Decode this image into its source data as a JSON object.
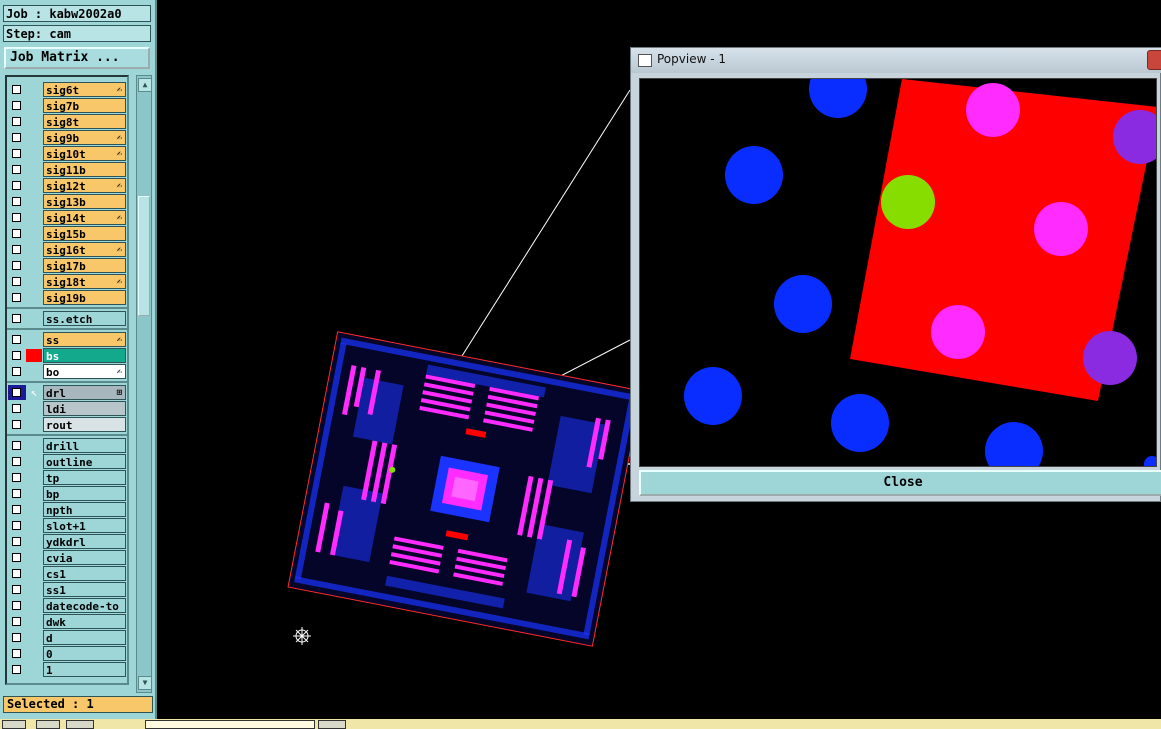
{
  "header": {
    "job": "Job : kabw2002a0",
    "step": "Step: cam",
    "job_matrix_label": "Job Matrix ..."
  },
  "layers": {
    "signal": [
      {
        "name": "sig6t",
        "mark": "✍"
      },
      {
        "name": "sig7b",
        "mark": ""
      },
      {
        "name": "sig8t",
        "mark": ""
      },
      {
        "name": "sig9b",
        "mark": "✍"
      },
      {
        "name": "sig10t",
        "mark": "✍"
      },
      {
        "name": "sig11b",
        "mark": ""
      },
      {
        "name": "sig12t",
        "mark": "✍"
      },
      {
        "name": "sig13b",
        "mark": ""
      },
      {
        "name": "sig14t",
        "mark": "✍"
      },
      {
        "name": "sig15b",
        "mark": ""
      },
      {
        "name": "sig16t",
        "mark": "✍"
      },
      {
        "name": "sig17b",
        "mark": ""
      },
      {
        "name": "sig18t",
        "mark": "✍"
      },
      {
        "name": "sig19b",
        "mark": ""
      }
    ],
    "etch": [
      {
        "name": "ss.etch"
      }
    ],
    "solder": [
      {
        "name": "ss",
        "mark": "✍"
      },
      {
        "name": "bs",
        "mark": ""
      },
      {
        "name": "bo",
        "mark": "✍"
      }
    ],
    "drill_group": [
      {
        "name": "drl",
        "mark": "⊞"
      },
      {
        "name": "ldi",
        "mark": ""
      },
      {
        "name": "rout",
        "mark": ""
      }
    ],
    "misc": [
      {
        "name": "drill"
      },
      {
        "name": "outline"
      },
      {
        "name": "tp"
      },
      {
        "name": "bp"
      },
      {
        "name": "npth"
      },
      {
        "name": "slot+1"
      },
      {
        "name": "ydkdrl"
      },
      {
        "name": "cvia"
      },
      {
        "name": "cs1"
      },
      {
        "name": "ss1"
      },
      {
        "name": "datecode-to"
      },
      {
        "name": "dwk"
      },
      {
        "name": "d"
      },
      {
        "name": "0"
      },
      {
        "name": "1"
      }
    ]
  },
  "status": {
    "selected": "Selected : 1"
  },
  "popview": {
    "title": "Popview - 1",
    "close_label": "Close"
  },
  "colors": {
    "panel_bg": "#9ed6d8",
    "signal_layer": "#f7c76a",
    "board_pad_blue": "#0a2dff",
    "board_pad_magenta": "#ff2bff",
    "board_copper_red": "#ff0000",
    "highlight_green": "#88dd00",
    "bs_active": "#12a98c",
    "bs_swatch": "#ff0000",
    "drl_bg": "#a7b7bd",
    "ldi_bg": "#b8c6cc",
    "rout_bg": "#d9e2e4"
  }
}
